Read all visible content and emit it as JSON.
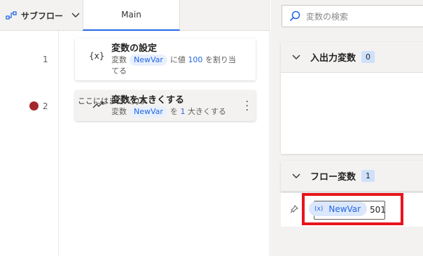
{
  "header": {
    "subflow_label": "サブフロー",
    "tab_main": "Main"
  },
  "lines": [
    "1",
    "2"
  ],
  "actions": [
    {
      "title": "変数の設定",
      "icon": "{x}",
      "desc_prefix": "変数",
      "variable": "NewVar",
      "desc_mid": "に値",
      "value": "100",
      "desc_suffix": "を割り当",
      "desc_line2": "てる"
    },
    {
      "title": "変数を大きくする",
      "desc_prefix": "変数",
      "variable": "NewVar",
      "desc_mid": "を",
      "value": "1",
      "desc_suffix": "大きくする"
    }
  ],
  "panel": {
    "search_placeholder": "変数の検索",
    "io_section": {
      "title": "入出力変数",
      "count": "0",
      "empty_message": "ここにはまだ入力ま"
    },
    "flow_section": {
      "title": "フロー変数",
      "count": "1"
    },
    "flow_variable": {
      "icon": "(x)",
      "name": "NewVar",
      "value": "501"
    }
  },
  "colors": {
    "accent": "#2266e3",
    "breakpoint": "#a4262c",
    "highlight": "#e8141c"
  }
}
